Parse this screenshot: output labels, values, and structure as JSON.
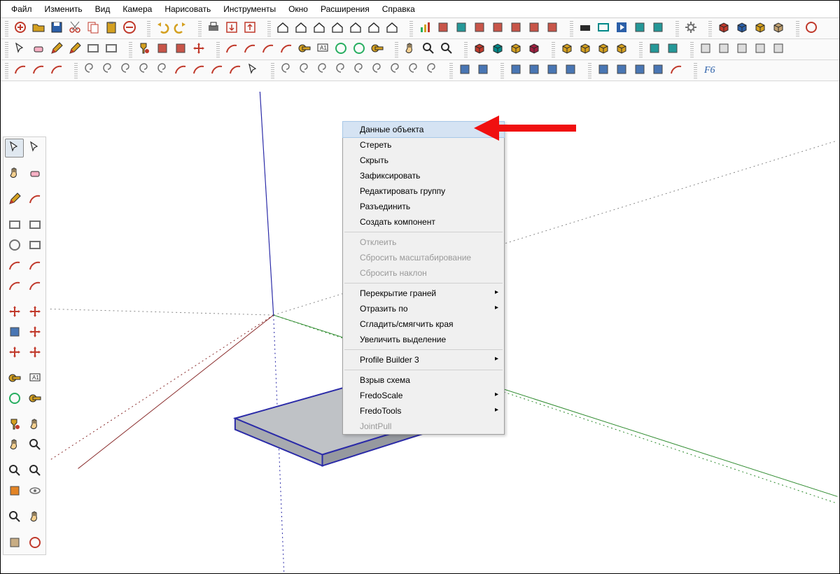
{
  "menubar": [
    "Файл",
    "Изменить",
    "Вид",
    "Камера",
    "Нарисовать",
    "Инструменты",
    "Окно",
    "Расширения",
    "Справка"
  ],
  "toolbar_row1": [
    "new-file",
    "open-file",
    "save-file",
    "cut",
    "copy",
    "paste",
    "delete",
    "",
    "undo",
    "redo",
    "",
    "print",
    "import",
    "export",
    "",
    "house-1",
    "house-2",
    "house-3",
    "house-4",
    "house-5",
    "house-6",
    "house-7",
    "",
    "bars",
    "plugin-red",
    "plugin-teal",
    "book-red",
    "fold",
    "spread",
    "books",
    "xray",
    "",
    "movie",
    "monitor",
    "play",
    "equalizer",
    "marker",
    "",
    "settings",
    "",
    "box-red",
    "box-blue",
    "box-gold",
    "box-tan",
    "",
    "target"
  ],
  "toolbar_row2": [
    "select",
    "eraser",
    "pencil",
    "pencil-alt",
    "shape-diamond",
    "shape-rect",
    "",
    "paint",
    "sticker-1",
    "sticker-2",
    "move-red",
    "",
    "arc-1",
    "arc-2",
    "arc-3",
    "arc-4",
    "tape",
    "text",
    "protractor-1",
    "protractor-2",
    "dimension",
    "",
    "hand",
    "zoom",
    "zoom-extents",
    "",
    "gem-red",
    "gem-teal",
    "gem-gold",
    "gem-ruby",
    "",
    "solid-1",
    "solid-2",
    "solid-3",
    "solid-4",
    "",
    "layers-1",
    "layers-2",
    "",
    "clip-1",
    "clip-2",
    "clip-3",
    "clip-4",
    "clip-5"
  ],
  "toolbar_row3": [
    "curve-1",
    "curve-2",
    "curve-3",
    "",
    "spiral-1",
    "spiral-2",
    "spiral-3",
    "spiral-4",
    "spiral-5",
    "sweep-1",
    "sweep-2",
    "sweep-3",
    "sweep-4",
    "select-box",
    "",
    "spiral-a",
    "spiral-b",
    "spiral-c",
    "spiral-d",
    "spiral-e",
    "spiral-f",
    "coil-1",
    "coil-2",
    "helix",
    "",
    "snap-1",
    "snap-2",
    "",
    "align-v",
    "arrows-ud",
    "arrows-du",
    "align-sq",
    "",
    "mirror-h",
    "mirror-v",
    "rotate-cw",
    "rotate-ccw",
    "bend",
    "",
    "fx-italic"
  ],
  "side_palette": [
    "select",
    "select-window",
    "camera-roll",
    "eraser",
    "pencil",
    "curve",
    "rect",
    "rect-rot",
    "circle",
    "polygon",
    "arc",
    "arc2",
    "pie",
    "bezier",
    "move",
    "offset",
    "rotate",
    "scale",
    "offset-tool",
    "push",
    "tape",
    "text",
    "protractor",
    "label",
    "paint",
    "walk",
    "orbit",
    "look",
    "pan",
    "zoom",
    "section",
    "eye",
    "zoom-ext",
    "position",
    "shoe",
    "target-final"
  ],
  "context_menu": [
    {
      "label": "Данные объекта",
      "type": "item",
      "hover": true
    },
    {
      "label": "Стереть",
      "type": "item"
    },
    {
      "label": "Скрыть",
      "type": "item"
    },
    {
      "label": "Зафиксировать",
      "type": "item"
    },
    {
      "label": "Редактировать группу",
      "type": "item"
    },
    {
      "label": "Разъединить",
      "type": "item"
    },
    {
      "label": "Создать компонент",
      "type": "item"
    },
    {
      "type": "sep"
    },
    {
      "label": "Отклеить",
      "type": "item",
      "disabled": true
    },
    {
      "label": "Сбросить масштабирование",
      "type": "item",
      "disabled": true
    },
    {
      "label": "Сбросить наклон",
      "type": "item",
      "disabled": true
    },
    {
      "type": "sep"
    },
    {
      "label": "Перекрытие граней",
      "type": "submenu"
    },
    {
      "label": "Отразить по",
      "type": "submenu"
    },
    {
      "label": "Сгладить/смягчить края",
      "type": "item"
    },
    {
      "label": "Увеличить выделение",
      "type": "item"
    },
    {
      "type": "sep"
    },
    {
      "label": "Profile Builder 3",
      "type": "submenu"
    },
    {
      "type": "sep"
    },
    {
      "label": "Взрыв схема",
      "type": "item"
    },
    {
      "label": "FredoScale",
      "type": "submenu"
    },
    {
      "label": "FredoTools",
      "type": "submenu"
    },
    {
      "label": "JointPull",
      "type": "item",
      "disabled": true
    }
  ],
  "icon_colors": {
    "red": "#c0392b",
    "green": "#27ae60",
    "blue": "#2b5fa8",
    "gold": "#d4a020",
    "teal": "#008888",
    "gray": "#707070",
    "black": "#2a2a2a",
    "orange": "#e07000"
  }
}
